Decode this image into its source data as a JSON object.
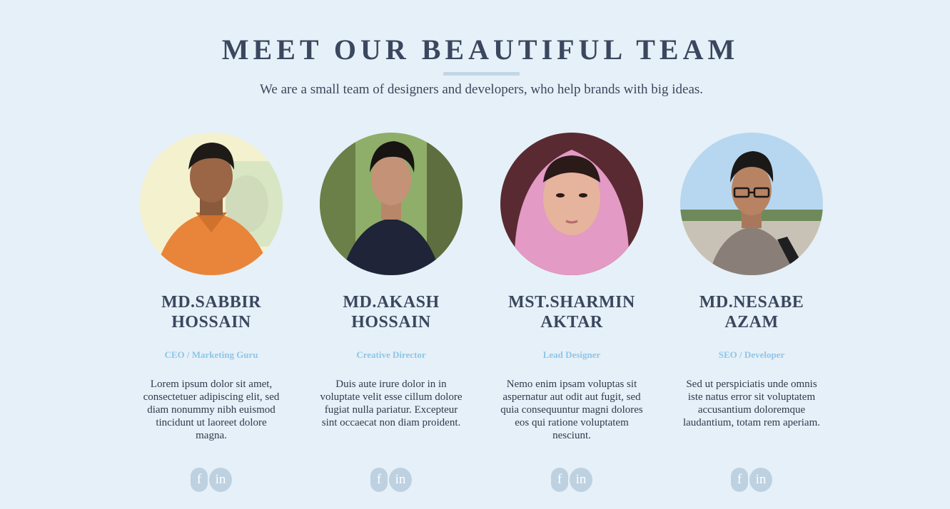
{
  "header": {
    "title": "MEET OUR BEAUTIFUL TEAM",
    "subtitle": "We are a small team of designers and developers, who help brands with big ideas."
  },
  "colors": {
    "background": "#e6f0f8",
    "heading": "#3a475e",
    "role": "#8ec6e8",
    "social_bg": "#bdd1e1"
  },
  "team": [
    {
      "name": "MD.SABBIR HOSSAIN",
      "role": "CEO / Marketing Guru",
      "bio": "Lorem ipsum dolor sit amet, consectetuer adipiscing elit, sed diam nonummy nibh euismod tincidunt ut laoreet dolore magna.",
      "facebook_icon": "f",
      "linkedin_icon": "in"
    },
    {
      "name": "MD.AKASH HOSSAIN",
      "role": "Creative Director",
      "bio": "Duis aute irure dolor in in voluptate velit esse cillum dolore fugiat nulla pariatur. Excepteur sint occaecat non diam proident.",
      "facebook_icon": "f",
      "linkedin_icon": "in"
    },
    {
      "name": "MST.SHARMIN AKTAR",
      "role": "Lead Designer",
      "bio": "Nemo enim ipsam voluptas sit aspernatur aut odit aut fugit, sed quia consequuntur magni dolores eos qui ratione voluptatem nesciunt.",
      "facebook_icon": "f",
      "linkedin_icon": "in"
    },
    {
      "name": "MD.NESABE AZAM",
      "role": "SEO / Developer",
      "bio": "Sed ut perspiciatis unde omnis iste natus error sit voluptatem accusantium doloremque laudantium, totam rem aperiam.",
      "facebook_icon": "f",
      "linkedin_icon": "in"
    }
  ]
}
